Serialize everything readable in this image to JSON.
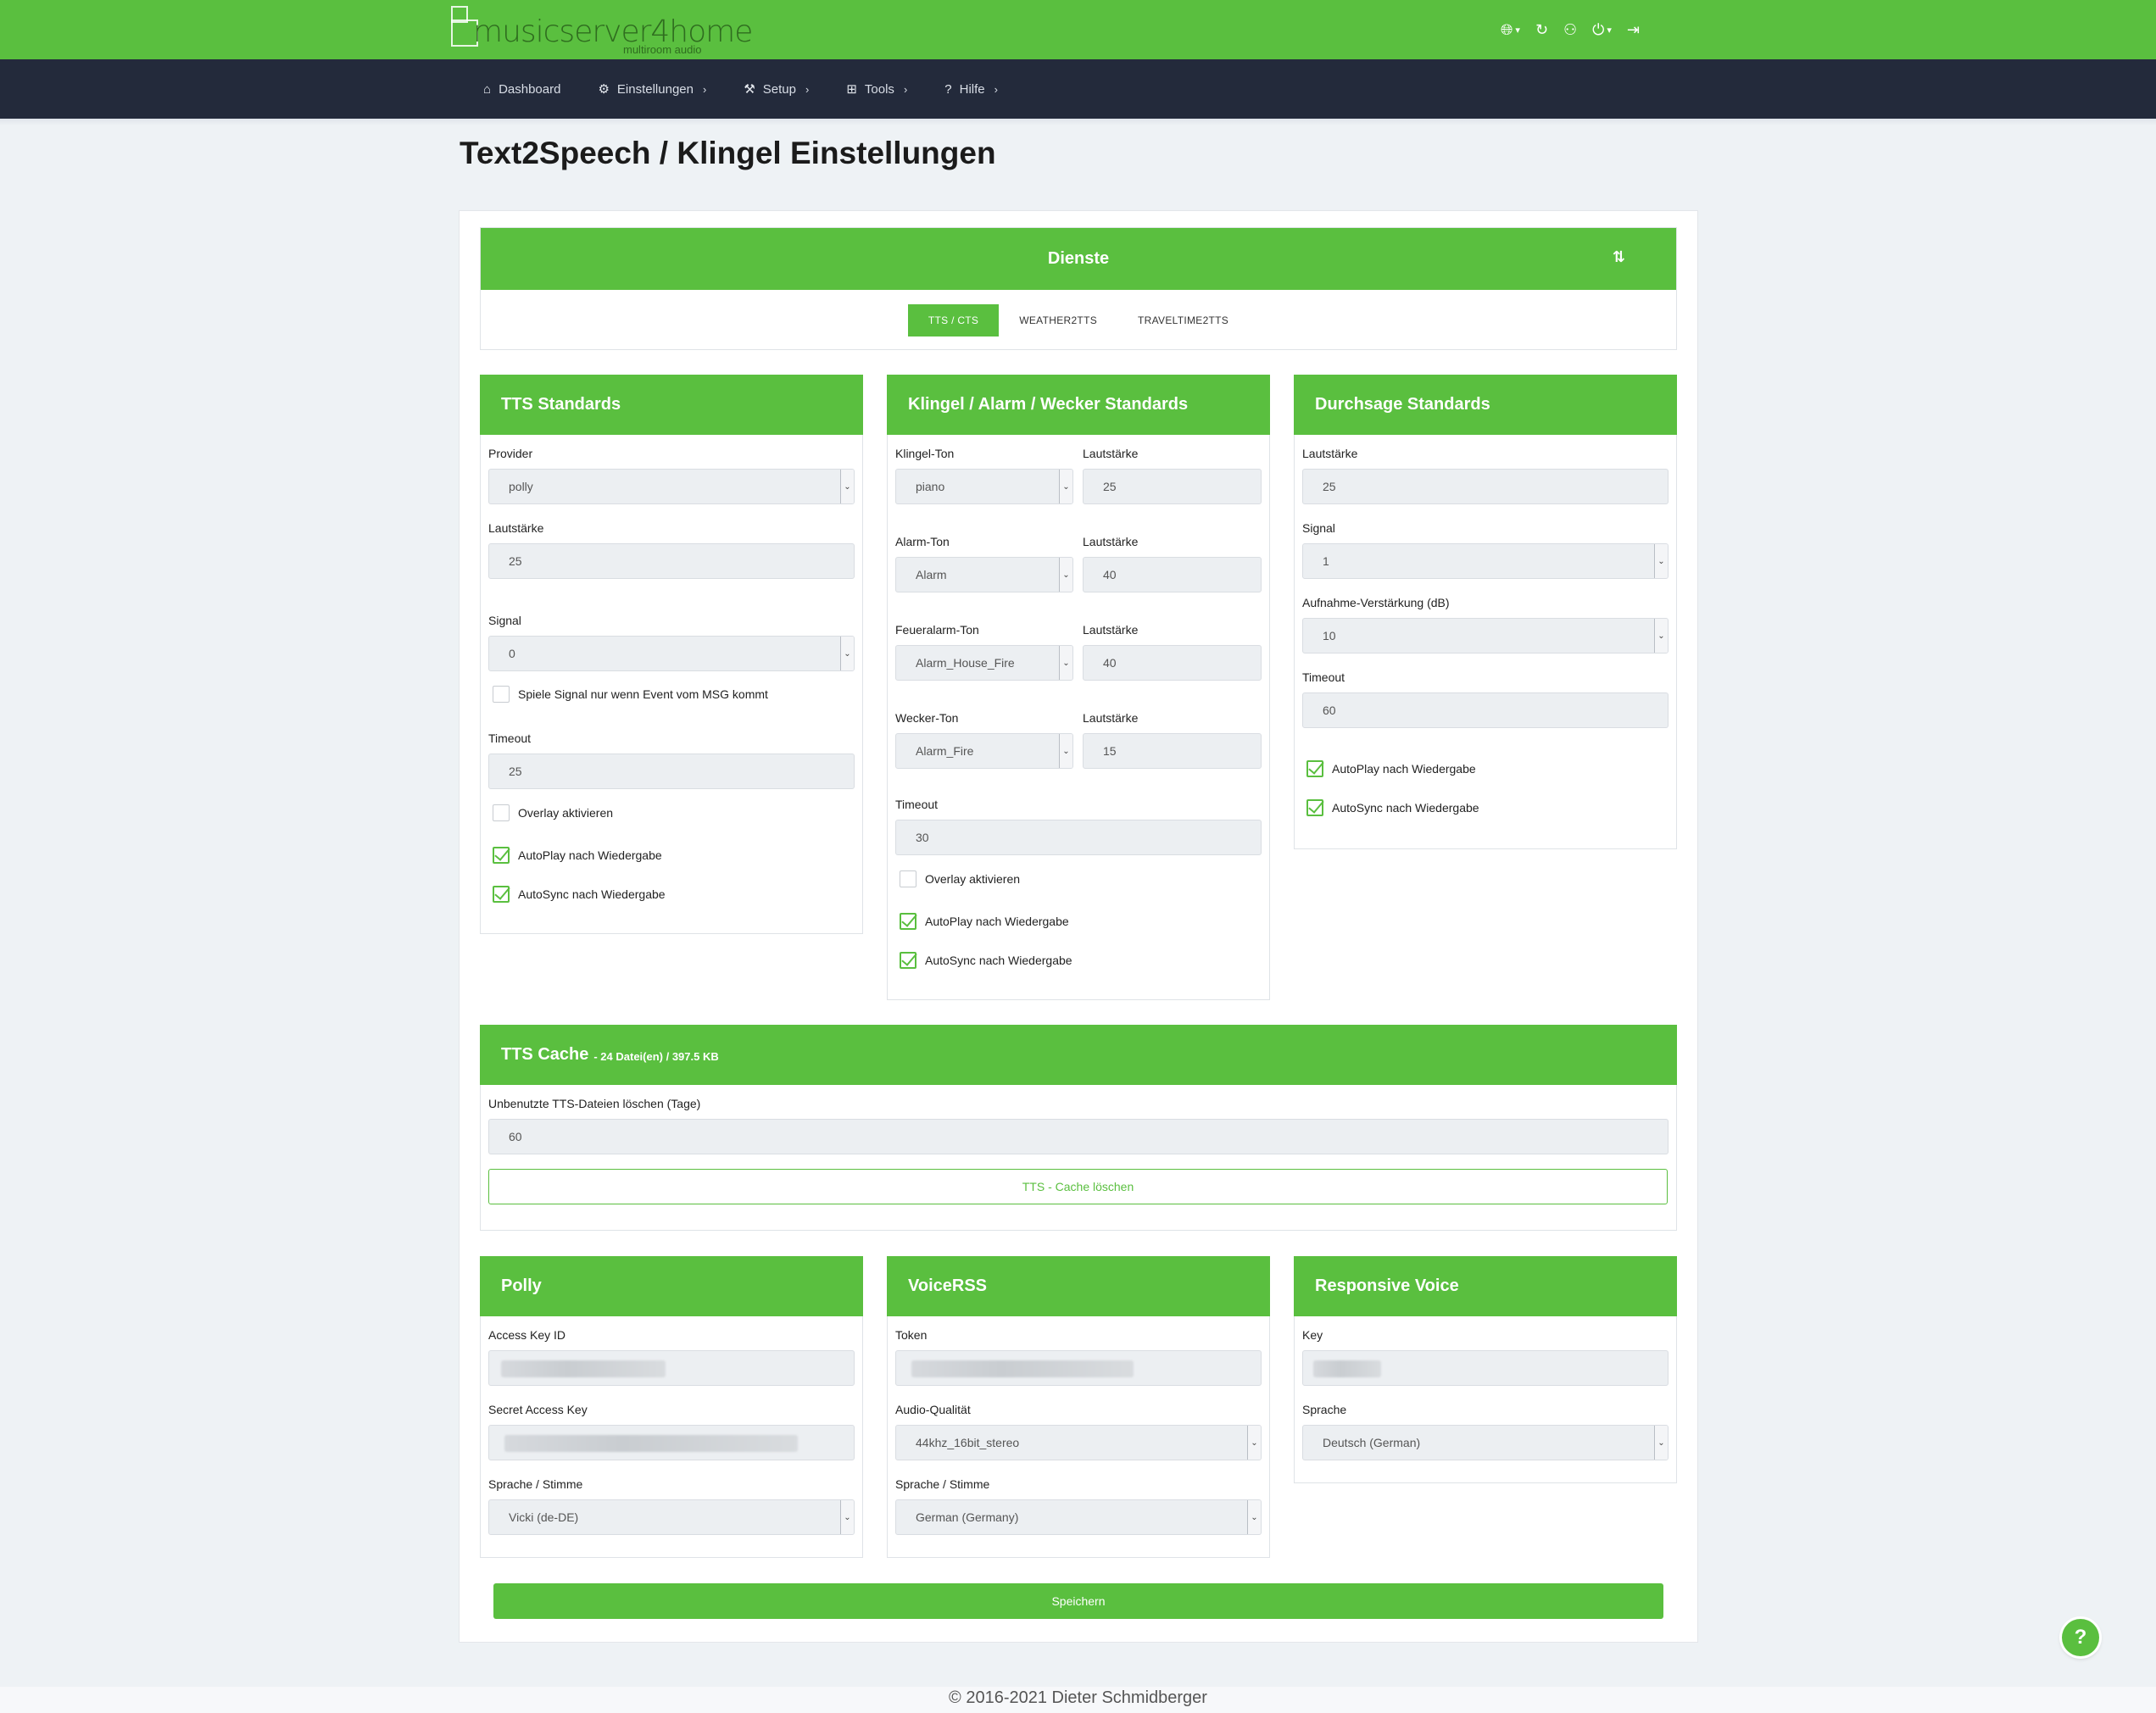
{
  "app": {
    "logo_name": "musicserver4home",
    "logo_tag": "multiroom audio"
  },
  "topbar_icons": [
    "globe-icon",
    "refresh-icon",
    "users-icon",
    "power-icon",
    "logout-icon"
  ],
  "nav": [
    {
      "icon": "home-icon",
      "label": "Dashboard"
    },
    {
      "icon": "gear-icon",
      "label": "Einstellungen"
    },
    {
      "icon": "wrench-icon",
      "label": "Setup"
    },
    {
      "icon": "plus-square-icon",
      "label": "Tools"
    },
    {
      "icon": "question-icon",
      "label": "Hilfe"
    }
  ],
  "page_title": "Text2Speech / Klingel Einstellungen",
  "dienste": {
    "title": "Dienste",
    "tabs": [
      "TTS / CTS",
      "WEATHER2TTS",
      "TRAVELTIME2TTS"
    ],
    "active_tab": "TTS / CTS"
  },
  "tts_standards": {
    "title": "TTS Standards",
    "provider_label": "Provider",
    "provider_value": "polly",
    "volume_label": "Lautstärke",
    "volume_value": "25",
    "signal_label": "Signal",
    "signal_value": "0",
    "signal_msg_label": "Spiele Signal nur wenn Event vom MSG kommt",
    "signal_msg_checked": false,
    "timeout_label": "Timeout",
    "timeout_value": "25",
    "overlay_label": "Overlay aktivieren",
    "overlay_checked": false,
    "autoplay_label": "AutoPlay nach Wiedergabe",
    "autoplay_checked": true,
    "autosync_label": "AutoSync nach Wiedergabe",
    "autosync_checked": true
  },
  "klingel": {
    "title": "Klingel / Alarm / Wecker Standards",
    "rows": [
      {
        "tone_label": "Klingel-Ton",
        "tone_value": "piano",
        "vol_label": "Lautstärke",
        "vol_value": "25"
      },
      {
        "tone_label": "Alarm-Ton",
        "tone_value": "Alarm",
        "vol_label": "Lautstärke",
        "vol_value": "40"
      },
      {
        "tone_label": "Feueralarm-Ton",
        "tone_value": "Alarm_House_Fire",
        "vol_label": "Lautstärke",
        "vol_value": "40"
      },
      {
        "tone_label": "Wecker-Ton",
        "tone_value": "Alarm_Fire",
        "vol_label": "Lautstärke",
        "vol_value": "15"
      }
    ],
    "timeout_label": "Timeout",
    "timeout_value": "30",
    "overlay_label": "Overlay aktivieren",
    "overlay_checked": false,
    "autoplay_label": "AutoPlay nach Wiedergabe",
    "autoplay_checked": true,
    "autosync_label": "AutoSync nach Wiedergabe",
    "autosync_checked": true
  },
  "durchsage": {
    "title": "Durchsage Standards",
    "volume_label": "Lautstärke",
    "volume_value": "25",
    "signal_label": "Signal",
    "signal_value": "1",
    "gain_label": "Aufnahme-Verstärkung (dB)",
    "gain_value": "10",
    "timeout_label": "Timeout",
    "timeout_value": "60",
    "autoplay_label": "AutoPlay nach Wiedergabe",
    "autoplay_checked": true,
    "autosync_label": "AutoSync nach Wiedergabe",
    "autosync_checked": true
  },
  "cache": {
    "title": "TTS Cache",
    "subtitle": "- 24 Datei(en) / 397.5 KB",
    "days_label": "Unbenutzte TTS-Dateien löschen (Tage)",
    "days_value": "60",
    "clear_button": "TTS - Cache löschen"
  },
  "polly": {
    "title": "Polly",
    "key_id_label": "Access Key ID",
    "secret_label": "Secret Access Key",
    "voice_label": "Sprache / Stimme",
    "voice_value": "Vicki (de-DE)"
  },
  "voicerss": {
    "title": "VoiceRSS",
    "token_label": "Token",
    "quality_label": "Audio-Qualität",
    "quality_value": "44khz_16bit_stereo",
    "voice_label": "Sprache / Stimme",
    "voice_value": "German (Germany)"
  },
  "responsive": {
    "title": "Responsive Voice",
    "key_label": "Key",
    "lang_label": "Sprache",
    "lang_value": "Deutsch (German)"
  },
  "save_button": "Speichern",
  "help_button": "?",
  "footer": "© 2016-2021 Dieter Schmidberger"
}
